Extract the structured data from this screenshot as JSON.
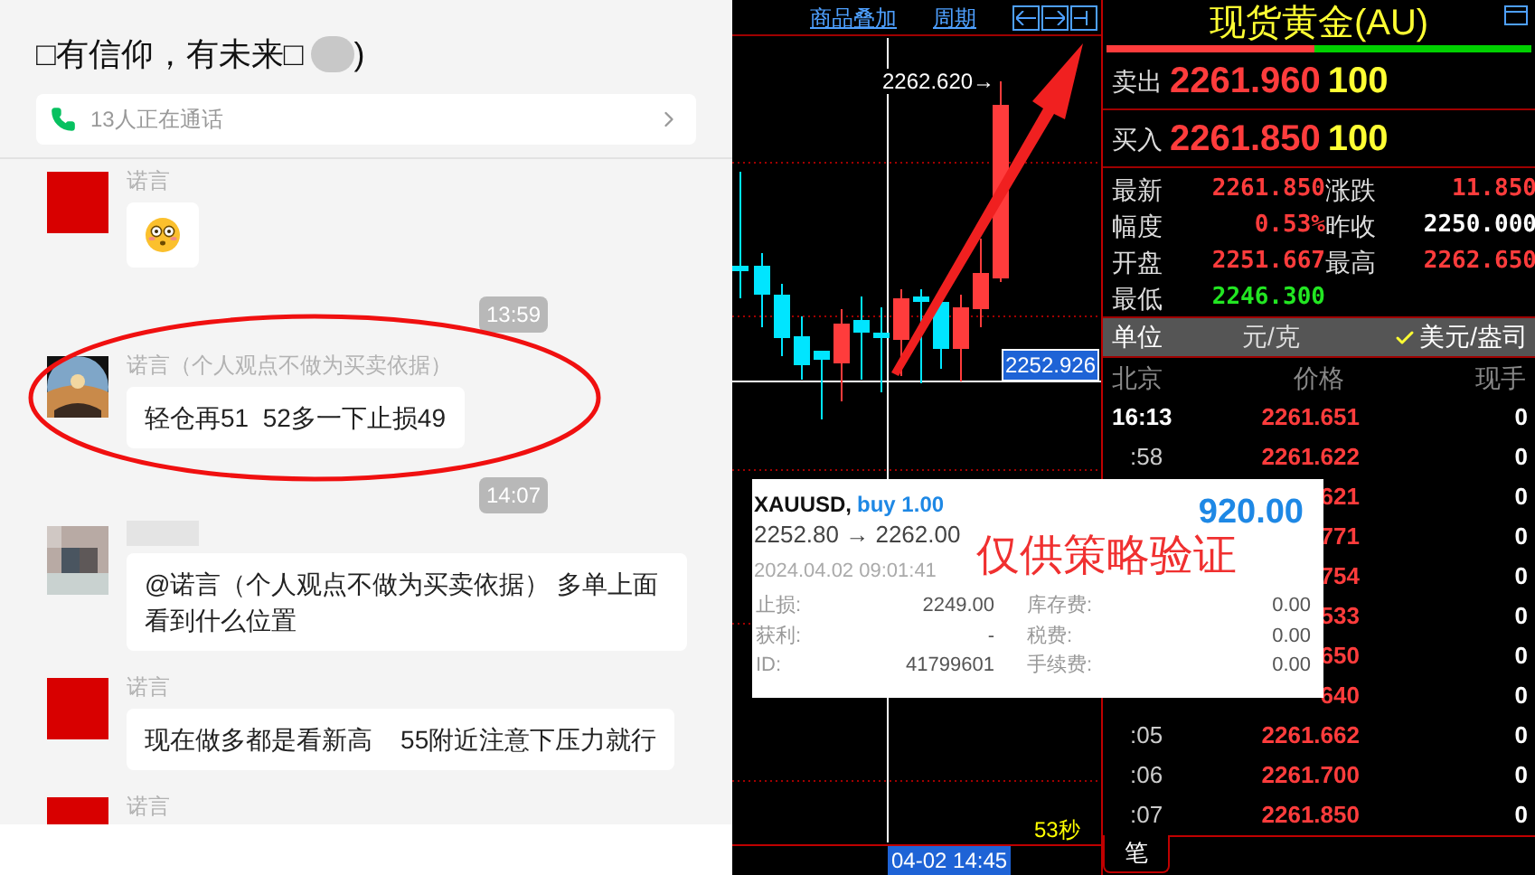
{
  "chat": {
    "title": "□有信仰，有未来□",
    "title_end": ")",
    "call_bar": {
      "text": "13人正在通话"
    },
    "items": [
      {
        "kind": "message",
        "sender": "诺言",
        "avatar": {
          "kind": "red"
        },
        "body": {
          "kind": "emoji"
        },
        "circled": false
      },
      {
        "kind": "time",
        "text": "13:59"
      },
      {
        "kind": "message",
        "sender": "诺言（个人观点不做为买卖依据）",
        "avatar": {
          "kind": "photo"
        },
        "body": {
          "kind": "text",
          "text": "轻仓再51  52多一下止损49"
        },
        "circled": true
      },
      {
        "kind": "time",
        "text": "14:07"
      },
      {
        "kind": "message",
        "avatar": {
          "kind": "pixelated"
        },
        "body": {
          "kind": "text",
          "text": "@诺言（个人观点不做为买卖依据） 多单上面看到什么位置"
        },
        "circled": false
      },
      {
        "kind": "message",
        "sender": "诺言",
        "avatar": {
          "kind": "red"
        },
        "body": {
          "kind": "text",
          "text": "现在做多都是看新高    55附近注意下压力就行"
        },
        "circled": false
      },
      {
        "kind": "message",
        "sender": "诺言",
        "avatar": {
          "kind": "red"
        },
        "circled": false
      }
    ]
  },
  "chart": {
    "toolbar_links": [
      "商品叠加",
      "周期"
    ],
    "high_label": "2262.620→",
    "price_tag": "2252.926",
    "countdown": "53秒",
    "time_tag": "04-02 14:45"
  },
  "quote": {
    "title": "现货黄金(AU)",
    "ratio_bar": {
      "level": 0.49
    },
    "book": [
      {
        "label": "卖出",
        "price": "2261.960",
        "volume": "100"
      },
      {
        "label": "买入",
        "price": "2261.850",
        "volume": "100"
      }
    ],
    "stats": [
      {
        "label": "最新",
        "value": "2261.850",
        "color": "#ff3c3c"
      },
      {
        "label": "涨跌",
        "value": "11.850",
        "color": "#ff3c3c"
      },
      {
        "label": "幅度",
        "value": "0.53%",
        "color": "#ff3c3c"
      },
      {
        "label": "昨收",
        "value": "2250.000",
        "color": "#ffffff"
      },
      {
        "label": "开盘",
        "value": "2251.667",
        "color": "#ff3c3c"
      },
      {
        "label": "最高",
        "value": "2262.650",
        "color": "#ff3c3c"
      },
      {
        "label": "最低",
        "value": "2246.300",
        "color": "#22e622"
      }
    ],
    "unit": {
      "label": "单位",
      "options": [
        {
          "text": "元/克",
          "selected": false
        },
        {
          "text": "美元/盎司",
          "selected": true
        }
      ]
    },
    "tick_columns": [
      "北京",
      "价格",
      "现手"
    ],
    "ticks": [
      {
        "time": "16:13",
        "price": "2261.651",
        "volume": "0",
        "current": true
      },
      {
        "time": ":58",
        "price": "2261.622",
        "volume": "0",
        "current": false
      },
      {
        "price": "621",
        "volume": "0"
      },
      {
        "price": "771",
        "volume": "0"
      },
      {
        "price": "754",
        "volume": "0"
      },
      {
        "price": "533",
        "volume": "0"
      },
      {
        "price": "650",
        "volume": "0"
      },
      {
        "price": "640",
        "volume": "0"
      },
      {
        "time": ":05",
        "price": "2261.662",
        "volume": "0",
        "current": false
      },
      {
        "time": ":06",
        "price": "2261.700",
        "volume": "0",
        "current": false
      },
      {
        "time": ":07",
        "price": "2261.850",
        "volume": "0",
        "current": false
      }
    ],
    "tabs": [
      {
        "label": "笔",
        "selected": true
      }
    ]
  },
  "popup": {
    "symbol": "XAUUSD,",
    "side": "buy 1.00",
    "prices": "2252.80 → 2262.00",
    "profit": "920.00",
    "time": "2024.04.02 09:01:41",
    "fields": [
      {
        "label": "止损:",
        "value": "2249.00"
      },
      {
        "label": "库存费:",
        "value": "0.00"
      },
      {
        "label": "获利:",
        "value": "-"
      },
      {
        "label": "税费:",
        "value": "0.00"
      },
      {
        "label": "ID:",
        "value": "41799601"
      },
      {
        "label": "手续费:",
        "value": "0.00"
      }
    ],
    "overlay_text": "仅供策略验证"
  }
}
